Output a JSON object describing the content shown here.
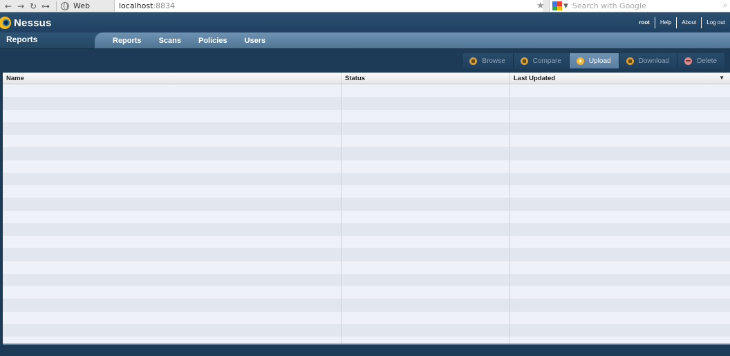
{
  "browser": {
    "back": "←",
    "forward": "→",
    "reload": "↻",
    "key": "⊶",
    "site_label": "Web",
    "url_host": "localhost",
    "url_port": ":8834",
    "search_placeholder": "Search with Google",
    "star": "★",
    "search_icon": "⌕"
  },
  "header": {
    "app_name": "Nessus",
    "user": "root",
    "links": [
      "Help",
      "About",
      "Log out"
    ]
  },
  "nav": {
    "page_title": "Reports",
    "tabs": [
      "Reports",
      "Scans",
      "Policies",
      "Users"
    ]
  },
  "toolbar": {
    "actions": [
      {
        "label": "Browse",
        "icon": "browse-icon",
        "active": false
      },
      {
        "label": "Compare",
        "icon": "compare-icon",
        "active": false
      },
      {
        "label": "Upload",
        "icon": "upload-icon",
        "active": true
      },
      {
        "label": "Download",
        "icon": "download-icon",
        "active": false
      },
      {
        "label": "Delete",
        "icon": "delete-icon",
        "active": false
      }
    ]
  },
  "table": {
    "columns": [
      "Name",
      "Status",
      "Last Updated"
    ],
    "sort_indicator": "▼",
    "rows": []
  },
  "colors": {
    "background": "#1d3b57",
    "tab_strip": "#5f84a4",
    "row_light": "#eef1f7",
    "row_dark": "#e2e6ee",
    "accent": "#f2b63a"
  }
}
